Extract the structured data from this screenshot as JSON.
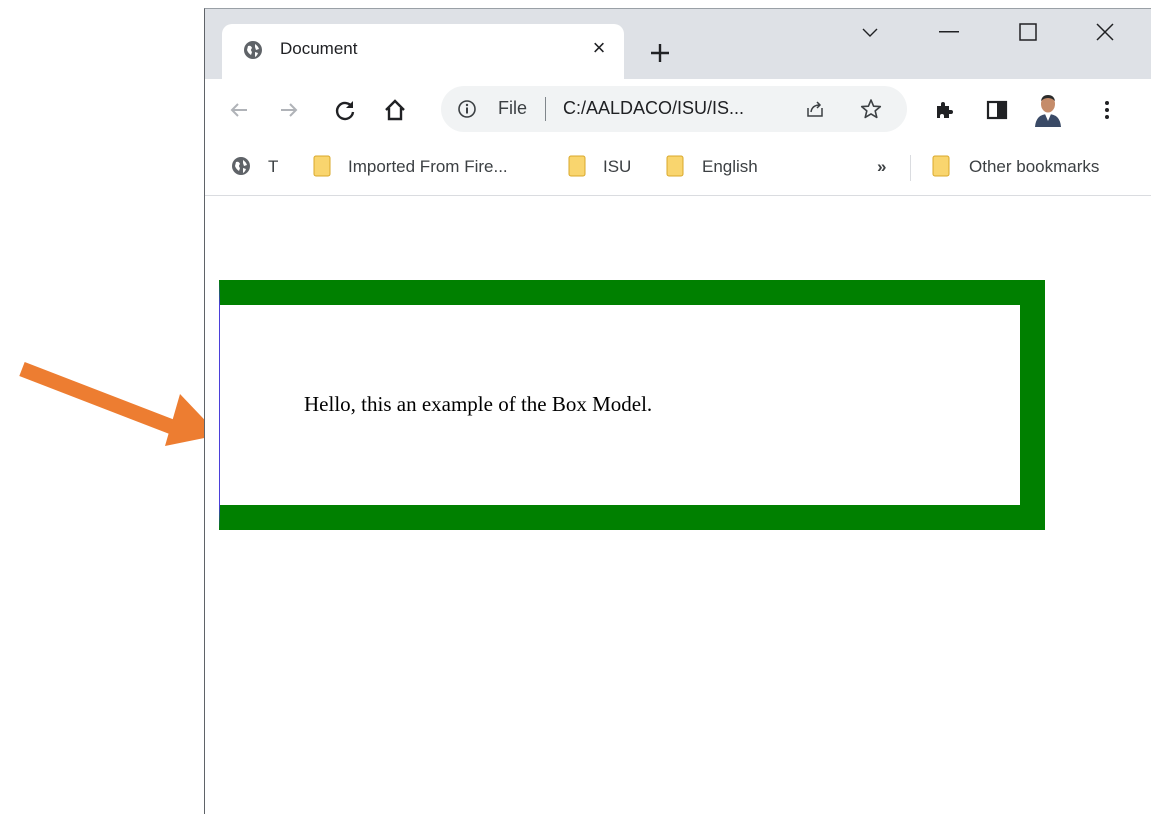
{
  "browser": {
    "tab": {
      "title": "Document",
      "icon": "globe-icon",
      "close_glyph": "×"
    },
    "new_tab_icon": "plus-icon",
    "tab_search_icon": "chevron-down-icon",
    "window_controls": [
      "minimize-icon",
      "maximize-icon",
      "close-icon"
    ]
  },
  "toolbar": {
    "nav_icons": [
      "back-arrow-icon",
      "forward-arrow-icon",
      "reload-icon",
      "home-icon"
    ],
    "address": {
      "info_icon": "info-icon",
      "scheme": "File",
      "url": "C:/AALDACO/ISU/IS..."
    },
    "share_icon": "share-icon",
    "star_icon": "star-icon",
    "extensions_icon": "puzzle-icon",
    "side_panel_icon": "side-panel-icon",
    "profile_icon": "profile-avatar",
    "menu_icon": "more-vert-icon"
  },
  "bookmarks": {
    "items": [
      {
        "label": "T",
        "icon": "globe-icon"
      },
      {
        "label": "Imported From Fire...",
        "icon": "folder-icon"
      },
      {
        "label": "ISU",
        "icon": "folder-icon"
      },
      {
        "label": "English",
        "icon": "folder-icon"
      }
    ],
    "overflow": "»",
    "other": {
      "label": "Other bookmarks",
      "icon": "folder-icon"
    }
  },
  "page": {
    "text": "Hello, this an example of the Box Model.",
    "border_color": "#008000",
    "left_border_color": "#4b3fd9"
  },
  "annotation": {
    "arrow_color": "#ed7d31"
  }
}
